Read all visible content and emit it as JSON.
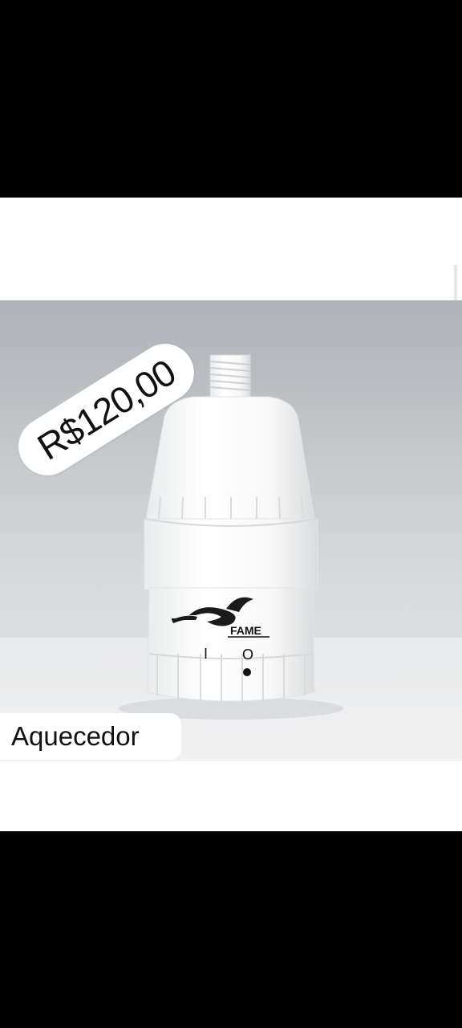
{
  "post": {
    "price": "R$120,00",
    "caption": "Aquecedor"
  },
  "product": {
    "brand": "FAME",
    "switch_off_symbol": "I",
    "switch_on_symbol": "O"
  },
  "colors": {
    "background_letterbox": "#000000",
    "background_post": "#ffffff",
    "pill_background": "#ffffff",
    "text": "#111111",
    "product_body": "#f6f6f6"
  }
}
